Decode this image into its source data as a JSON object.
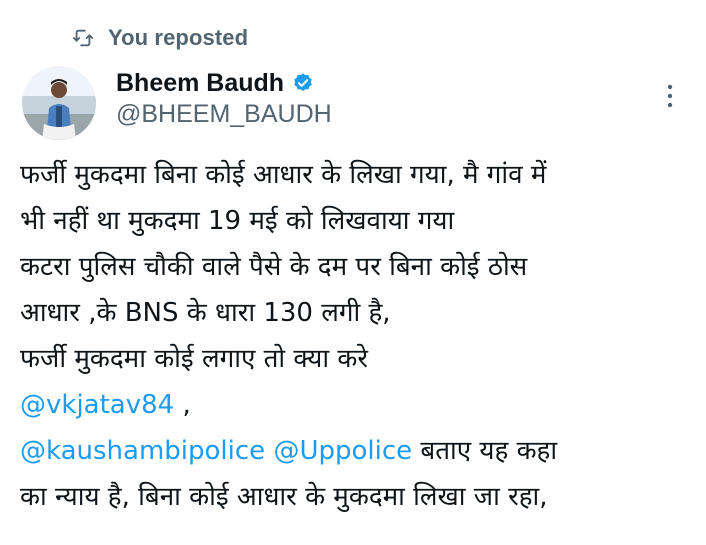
{
  "repost": {
    "icon": "repost-icon",
    "label": "You reposted"
  },
  "author": {
    "name": "Bheem Baudh",
    "handle": "@BHEEM_BAUDH",
    "verified_icon": "verified-badge-icon",
    "verified_color": "#1d9bf0"
  },
  "more_icon": "more-vertical-icon",
  "tweet": {
    "line1": "फर्जी मुकदमा बिना कोई आधार के लिखा गया, मै गांव में",
    "line2": "भी नहीं था मुकदमा 19 मई को लिखवाया गया",
    "line3": "कटरा पुलिस चौकी वाले पैसे के दम पर बिना कोई ठोस",
    "line4": "आधार ,के BNS के धारा 130 लगी है,",
    "line5": "फर्जी मुकदमा कोई लगाए तो क्या करे",
    "line6_mention": "@vkjatav84",
    "line6_rest": " ,",
    "line7_mention1": "@kaushambipolice",
    "line7_space": " ",
    "line7_mention2": "@Uppolice",
    "line7_rest": " बताए यह कहा",
    "line8": "का न्याय है, बिना कोई आधार के मुकदमा लिखा जा रहा,"
  },
  "colors": {
    "text": "#0f1419",
    "secondary": "#536471",
    "link": "#1d9bf0"
  }
}
